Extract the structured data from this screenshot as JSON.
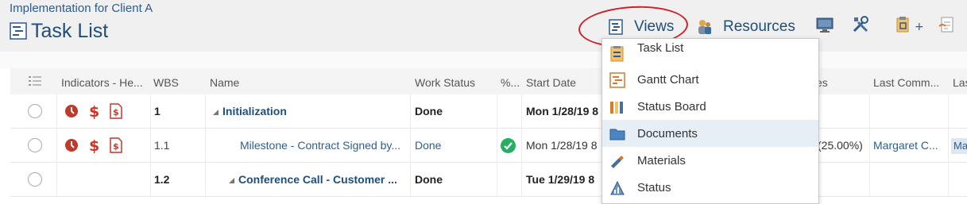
{
  "header": {
    "project_name": "Implementation for Client A",
    "page_title": "Task List"
  },
  "toolbar": {
    "views_label": "Views",
    "resources_label": "Resources"
  },
  "grid": {
    "columns": [
      "Indicators - He...",
      "WBS",
      "Name",
      "Work Status",
      "%...",
      "Start Date",
      "es",
      "Last Comm...",
      "Las"
    ],
    "rows": [
      {
        "wbs": "1",
        "name": "Initialization",
        "work_status": "Done",
        "start_date": "Mon 1/28/19 8",
        "extra": "",
        "last_comment": "",
        "last": ""
      },
      {
        "wbs": "1.1",
        "name": "Milestone - Contract Signed by...",
        "work_status": "Done",
        "start_date": "Mon 1/28/19 8",
        "extra": "(25.00%)",
        "last_comment": "Margaret C...",
        "last": "Ma"
      },
      {
        "wbs": "1.2",
        "name": "Conference Call -  Customer ...",
        "work_status": "Done",
        "start_date": "Tue 1/29/19 8",
        "extra": "",
        "last_comment": "",
        "last": ""
      }
    ]
  },
  "views_menu": {
    "items": [
      {
        "label": "Task List"
      },
      {
        "label": "Gantt Chart"
      },
      {
        "label": "Status Board"
      },
      {
        "label": "Documents"
      },
      {
        "label": "Materials"
      },
      {
        "label": "Status"
      }
    ]
  },
  "colors": {
    "accent": "#1f4e79",
    "link": "#2c5f8f",
    "indicator_red": "#c0392b",
    "check_green": "#27ae60",
    "highlight_oval": "#d21f2a"
  },
  "icons": [
    "task-list-icon",
    "views-icon",
    "resources-icon",
    "monitor-icon",
    "tools-icon",
    "clipboard-add-icon",
    "document-link-icon",
    "clock-icon",
    "dollar-icon",
    "document-dollar-icon",
    "column-chooser-icon",
    "gantt-chart-icon",
    "status-board-icon",
    "folder-icon",
    "materials-icon",
    "status-icon",
    "check-icon"
  ]
}
